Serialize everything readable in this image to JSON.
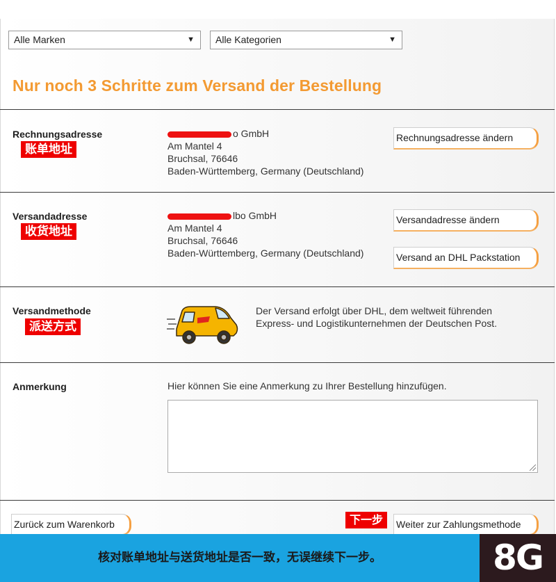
{
  "filters": {
    "brand": "Alle Marken",
    "category": "Alle Kategorien"
  },
  "headline": "Nur noch 3 Schritte zum Versand der Bestellung",
  "billing": {
    "label": "Rechnungsadresse",
    "cn_tag": "账单地址",
    "company_suffix": "o GmbH",
    "street": "Am Mantel 4",
    "city": "Bruchsal, 76646",
    "region": "Baden-Württemberg, Germany (Deutschland)",
    "change_button": "Rechnungsadresse ändern"
  },
  "shipping_address": {
    "label": "Versandadresse",
    "cn_tag": "收货地址",
    "company_suffix": "lbo GmbH",
    "street": "Am Mantel 4",
    "city": "Bruchsal, 76646",
    "region": "Baden-Württemberg, Germany (Deutschland)",
    "change_button": "Versandadresse ändern",
    "packstation_button": "Versand an DHL Packstation"
  },
  "shipping_method": {
    "label": "Versandmethode",
    "cn_tag": "派送方式",
    "line1": "Der Versand erfolgt über DHL, dem weltweit führenden",
    "line2": "Express- und Logistikunternehmen der Deutschen Post."
  },
  "note": {
    "label": "Anmerkung",
    "hint": "Hier können Sie eine Anmerkung zu Ihrer Bestellung hinzufügen.",
    "value": ""
  },
  "nav": {
    "back_button": "Zurück zum Warenkorb",
    "next_cn_tag": "下一步",
    "next_button": "Weiter zur Zahlungsmethode"
  },
  "footer": {
    "caption": "核对账单地址与送货地址是否一致，无误继续下一步。",
    "logo": "8G"
  },
  "colors": {
    "accent_orange": "#f39a32",
    "tag_red": "#ee0000",
    "footer_blue": "#1aa3e0"
  }
}
